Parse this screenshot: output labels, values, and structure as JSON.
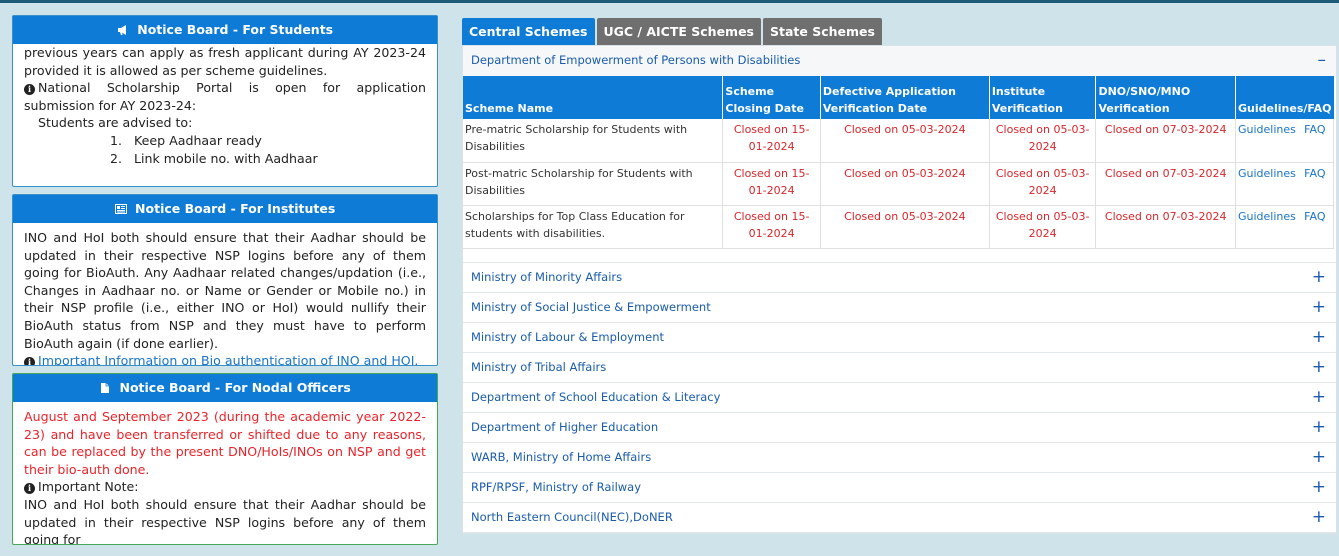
{
  "students": {
    "title": "Notice Board - For Students",
    "line1": "previous years can apply as fresh applicant during AY 2023-24 provided it is allowed as per scheme guidelines.",
    "line2": "National Scholarship Portal is open for application submission for AY 2023-24:",
    "advised": "Students are advised to:",
    "items": [
      {
        "num": "1.",
        "text": "Keep Aadhaar ready"
      },
      {
        "num": "2.",
        "text": "Link mobile no. with Aadhaar"
      }
    ]
  },
  "institutes": {
    "title": "Notice Board - For Institutes",
    "para": "INO and HoI both should ensure that their Aadhar should be updated in their respective NSP logins before any of them going for BioAuth. Any Aadhaar related changes/updation (i.e., Changes in Aadhaar no. or Name or Gender or Mobile no.) in their NSP profile (i.e., either INO or HoI) would nullify their BioAuth status from NSP and they must have to perform BioAuth again (if done earlier).",
    "link": "Important Information on Bio authentication of INO and HOI."
  },
  "nodal": {
    "title": "Notice Board - For Nodal Officers",
    "red": "August and September 2023 (during the academic year 2022-23) and have been transferred or shifted due to any reasons, can be replaced by the present DNO/HoIs/INOs on NSP and get their bio-auth done.",
    "note": "Important Note:",
    "para": "INO and HoI both should ensure that their Aadhar should be updated in their respective NSP logins before any of them going for"
  },
  "tabs": [
    "Central Schemes",
    "UGC / AICTE Schemes",
    "State Schemes"
  ],
  "department": {
    "name": "Department of Empowerment of Persons with Disabilities",
    "sign": "–",
    "headers": [
      "Scheme Name",
      "Scheme Closing Date",
      "Defective Application Verification Date",
      "Institute Verification",
      "DNO/SNO/MNO Verification",
      "Guidelines/FAQ"
    ],
    "rows": [
      {
        "name": "Pre-matric Scholarship for Students with Disabilities",
        "closing": "Closed on 15-01-2024",
        "defective": "Closed on 05-03-2024",
        "institute": "Closed on 05-03-2024",
        "dno": "Closed on 07-03-2024",
        "guidelines": "Guidelines",
        "faq": "FAQ"
      },
      {
        "name": "Post-matric Scholarship for Students with Disabilities",
        "closing": "Closed on 15-01-2024",
        "defective": "Closed on 05-03-2024",
        "institute": "Closed on 05-03-2024",
        "dno": "Closed on 07-03-2024",
        "guidelines": "Guidelines",
        "faq": "FAQ"
      },
      {
        "name": "Scholarships for Top Class Education for students with disabilities.",
        "closing": "Closed on 15-01-2024",
        "defective": "Closed on 05-03-2024",
        "institute": "Closed on 05-03-2024",
        "dno": "Closed on 07-03-2024",
        "guidelines": "Guidelines",
        "faq": "FAQ"
      }
    ]
  },
  "ministries": [
    "Ministry of Minority Affairs",
    "Ministry of Social Justice & Empowerment",
    "Ministry of Labour & Employment",
    "Ministry of Tribal Affairs",
    "Department of School Education & Literacy",
    "Department of Higher Education",
    "WARB, Ministry of Home Affairs",
    "RPF/RPSF, Ministry of Railway",
    "North Eastern Council(NEC),DoNER"
  ],
  "expand_sign": "+",
  "colors": {
    "header_blue": "#0e7bd6",
    "link_blue": "#1a5cab",
    "closed_red": "#d8262a",
    "tab_grey": "#6f6f6f"
  }
}
